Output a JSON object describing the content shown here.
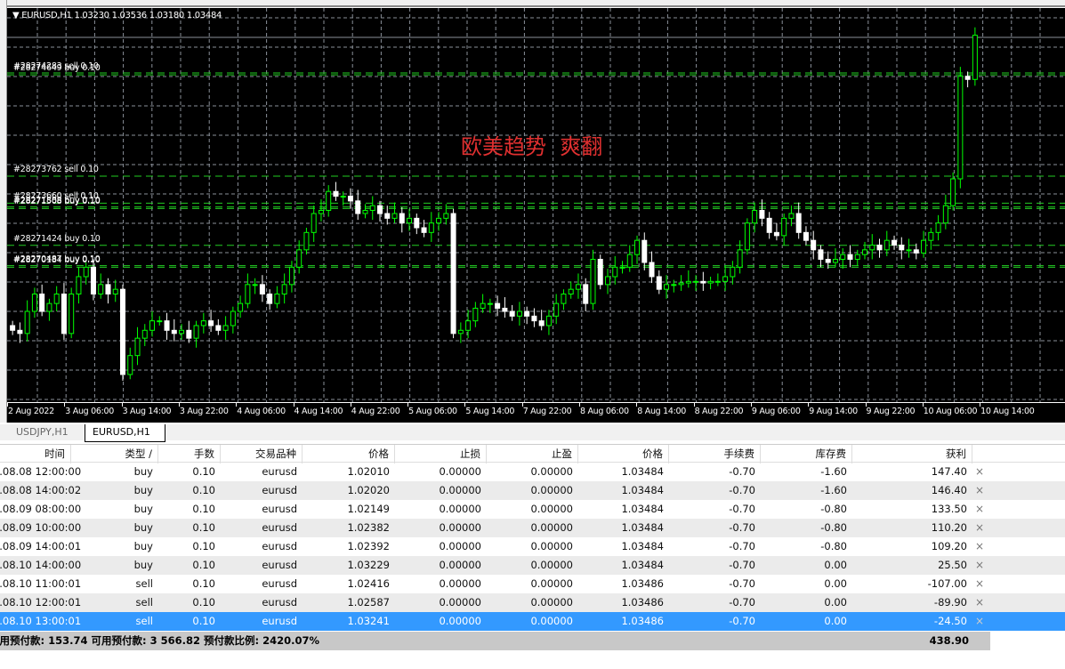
{
  "chart": {
    "header": "EURUSD,H1  1.03230 1.03536 1.03180 1.03484",
    "annotation": "欧美趋势  爽翻",
    "colors": {
      "background": "#000000",
      "grid": "#8a9099",
      "bull": "#00ff00",
      "bear": "#ffffff",
      "order_line": "#22cc22",
      "annotation": "#e03030"
    },
    "x_labels": [
      "2 Aug 2022",
      "3 Aug 06:00",
      "3 Aug 14:00",
      "3 Aug 22:00",
      "4 Aug 06:00",
      "4 Aug 14:00",
      "4 Aug 22:00",
      "5 Aug 06:00",
      "5 Aug 14:00",
      "7 Aug 22:00",
      "8 Aug 06:00",
      "8 Aug 14:00",
      "8 Aug 22:00",
      "9 Aug 06:00",
      "9 Aug 14:00",
      "9 Aug 22:00",
      "10 Aug 06:00",
      "10 Aug 14:00"
    ],
    "closes": [
      1.0161,
      1.0159,
      1.0173,
      1.0184,
      1.0173,
      1.0178,
      1.0184,
      1.0159,
      1.0184,
      1.0195,
      1.0201,
      1.0184,
      1.019,
      1.0184,
      1.0187,
      1.0133,
      1.0145,
      1.0156,
      1.0161,
      1.0167,
      1.0167,
      1.0161,
      1.0159,
      1.0161,
      1.0156,
      1.0164,
      1.0167,
      1.0164,
      1.0161,
      1.0164,
      1.0173,
      1.0178,
      1.019,
      1.019,
      1.0184,
      1.0178,
      1.0184,
      1.019,
      1.0201,
      1.0212,
      1.0223,
      1.0235,
      1.0237,
      1.0249,
      1.0246,
      1.0246,
      1.0243,
      1.0235,
      1.0237,
      1.024,
      1.0235,
      1.0232,
      1.0235,
      1.0229,
      1.0232,
      1.0226,
      1.0223,
      1.0229,
      1.0232,
      1.0235,
      1.0159,
      1.0161,
      1.0167,
      1.0175,
      1.0178,
      1.0178,
      1.0175,
      1.0173,
      1.017,
      1.0173,
      1.017,
      1.0167,
      1.0164,
      1.017,
      1.0178,
      1.0184,
      1.0187,
      1.019,
      1.0178,
      1.0206,
      1.019,
      1.0195,
      1.0201,
      1.0201,
      1.0209,
      1.0218,
      1.0204,
      1.0195,
      1.0187,
      1.019,
      1.019,
      1.0191,
      1.0192,
      1.0192,
      1.0191,
      1.0192,
      1.0192,
      1.0195,
      1.0201,
      1.0212,
      1.0229,
      1.0237,
      1.0232,
      1.0223,
      1.0221,
      1.0232,
      1.0235,
      1.0223,
      1.0218,
      1.0212,
      1.0206,
      1.0204,
      1.0206,
      1.0209,
      1.0206,
      1.0209,
      1.0212,
      1.0215,
      1.0212,
      1.0218,
      1.0215,
      1.0212,
      1.0212,
      1.021,
      1.0218,
      1.0223,
      1.0229,
      1.024,
      1.0257,
      1.0322,
      1.032,
      1.0348
    ],
    "order_lines": [
      {
        "label": "#28274283 sell 0.10",
        "price": 1.03241
      },
      {
        "label": "#28274649 buy 0.10",
        "price": 1.03229
      },
      {
        "label": "#28273762 sell 0.10",
        "price": 1.02587
      },
      {
        "label": "#28273660 sell 0.10",
        "price": 1.02416
      },
      {
        "label": "#28271888 buy 0.10",
        "price": 1.02392
      },
      {
        "label": "#28271508 buy 0.10",
        "price": 1.02382
      },
      {
        "label": "#28271424 buy 0.10",
        "price": 1.02149
      },
      {
        "label": "#28270487 buy 0.10",
        "price": 1.0202
      },
      {
        "label": "#28270184 buy 0.10",
        "price": 1.0201
      }
    ]
  },
  "tabs": [
    {
      "label": "USDJPY,H1",
      "active": false
    },
    {
      "label": "EURUSD,H1",
      "active": true
    }
  ],
  "table": {
    "headers": [
      "时间",
      "类型  /",
      "手数",
      "交易品种",
      "价格",
      "止损",
      "止盈",
      "价格",
      "手续费",
      "库存费",
      "获利"
    ],
    "rows": [
      [
        "2022.08.08 12:00:00",
        "buy",
        "0.10",
        "eurusd",
        "1.02010",
        "0.00000",
        "0.00000",
        "1.03484",
        "-0.70",
        "-1.60",
        "147.40"
      ],
      [
        "2022.08.08 14:00:02",
        "buy",
        "0.10",
        "eurusd",
        "1.02020",
        "0.00000",
        "0.00000",
        "1.03484",
        "-0.70",
        "-1.60",
        "146.40"
      ],
      [
        "2022.08.09 08:00:00",
        "buy",
        "0.10",
        "eurusd",
        "1.02149",
        "0.00000",
        "0.00000",
        "1.03484",
        "-0.70",
        "-0.80",
        "133.50"
      ],
      [
        "2022.08.09 10:00:00",
        "buy",
        "0.10",
        "eurusd",
        "1.02382",
        "0.00000",
        "0.00000",
        "1.03484",
        "-0.70",
        "-0.80",
        "110.20"
      ],
      [
        "2022.08.09 14:00:01",
        "buy",
        "0.10",
        "eurusd",
        "1.02392",
        "0.00000",
        "0.00000",
        "1.03484",
        "-0.70",
        "-0.80",
        "109.20"
      ],
      [
        "2022.08.10 14:00:00",
        "buy",
        "0.10",
        "eurusd",
        "1.03229",
        "0.00000",
        "0.00000",
        "1.03484",
        "-0.70",
        "0.00",
        "25.50"
      ],
      [
        "2022.08.10 11:00:01",
        "sell",
        "0.10",
        "eurusd",
        "1.02416",
        "0.00000",
        "0.00000",
        "1.03486",
        "-0.70",
        "0.00",
        "-107.00"
      ],
      [
        "2022.08.10 12:00:01",
        "sell",
        "0.10",
        "eurusd",
        "1.02587",
        "0.00000",
        "0.00000",
        "1.03486",
        "-0.70",
        "0.00",
        "-89.90"
      ],
      [
        "2022.08.10 13:00:01",
        "sell",
        "0.10",
        "eurusd",
        "1.03241",
        "0.00000",
        "0.00000",
        "1.03486",
        "-0.70",
        "0.00",
        "-24.50"
      ]
    ],
    "selected_row": 8,
    "close_icon": "×"
  },
  "footer": {
    "summary": "已用预付款: 153.74  可用预付款: 3 566.82  预付款比例: 2420.07%",
    "total_profit": "438.90"
  }
}
